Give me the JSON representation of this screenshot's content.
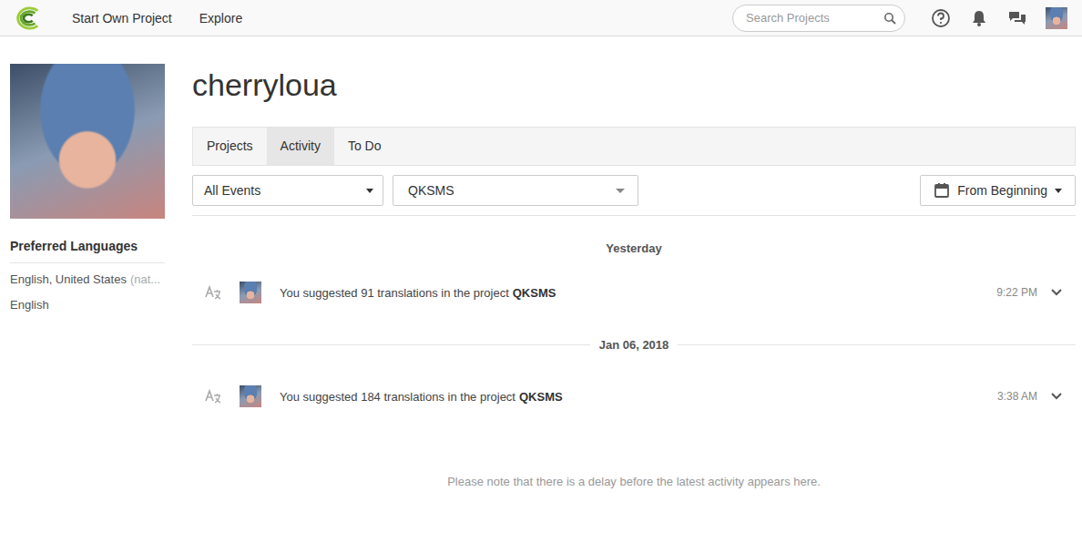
{
  "nav": {
    "links": [
      "Start Own Project",
      "Explore"
    ],
    "search_placeholder": "Search Projects"
  },
  "profile": {
    "username": "cherryloua",
    "languages_title": "Preferred Languages",
    "languages": [
      {
        "name": "English, United States",
        "note": "(nat..."
      },
      {
        "name": "English",
        "note": ""
      }
    ]
  },
  "tabs": [
    {
      "label": "Projects",
      "selected": false
    },
    {
      "label": "Activity",
      "selected": true
    },
    {
      "label": "To Do",
      "selected": false
    }
  ],
  "filters": {
    "event": "All Events",
    "project": "QKSMS",
    "range": "From Beginning"
  },
  "feed": [
    {
      "date": "Yesterday",
      "kind": "plain",
      "events": [
        {
          "text": "You suggested 91 translations in the project",
          "project": "QKSMS",
          "time": "9:22 PM",
          "expanded": false
        }
      ]
    },
    {
      "date": "Jan 06, 2018",
      "kind": "divider",
      "events": [
        {
          "text": "You suggested 184 translations in the project",
          "project": "QKSMS",
          "time": "3:38 AM",
          "expanded": false
        }
      ]
    }
  ],
  "note": "Please note that there is a delay before the latest activity appears here."
}
